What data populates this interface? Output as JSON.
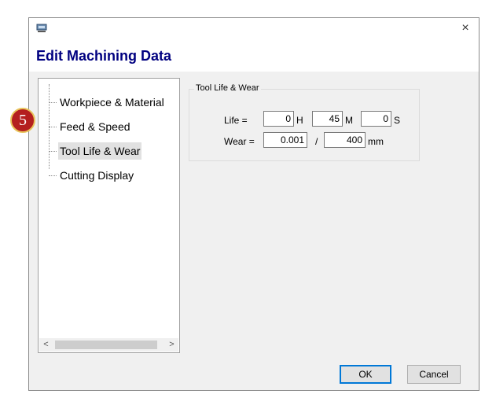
{
  "window": {
    "icon": "app-icon",
    "close_label": "×"
  },
  "header": {
    "title": "Edit Machining Data"
  },
  "tree": {
    "items": [
      {
        "label": "Workpiece & Material",
        "selected": false
      },
      {
        "label": "Feed & Speed",
        "selected": false
      },
      {
        "label": "Tool Life & Wear",
        "selected": true
      },
      {
        "label": "Cutting Display",
        "selected": false
      }
    ],
    "scroll_left": "<",
    "scroll_right": ">"
  },
  "tool_life": {
    "group_title": "Tool Life & Wear",
    "life_label": "Life =",
    "hours": "0",
    "hours_unit": "H",
    "minutes": "45",
    "minutes_unit": "M",
    "seconds": "0",
    "seconds_unit": "S",
    "wear_label": "Wear =",
    "wear_value": "0.001",
    "wear_separator": "/",
    "wear_length": "400",
    "wear_unit": "mm"
  },
  "buttons": {
    "ok": "OK",
    "cancel": "Cancel"
  },
  "callout": {
    "number": "5"
  },
  "colors": {
    "title": "#000080",
    "badge": "#b41f1f",
    "badge_border": "#e8c45a",
    "focus": "#0078d7"
  }
}
